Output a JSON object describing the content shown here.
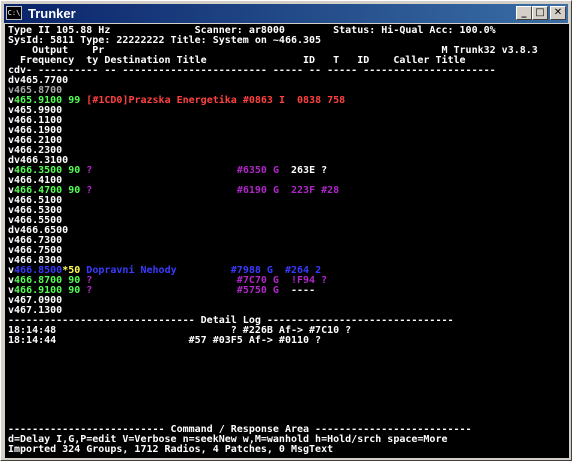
{
  "window": {
    "title": "Trunker",
    "icon_label": "C:\\",
    "buttons": {
      "minimize": "_",
      "maximize": "□",
      "close": "✕"
    }
  },
  "header": {
    "line1": "Type II 105.88 Hz              Scanner: ar8000        Status: Hi-Qual Acc: 100.0%",
    "line2": "SysId: 5811 Type: 22222222 Title: System on ~466.305",
    "line3": "    Output    Pr                                                        M Trunk32 v3.8.3",
    "line4": "  Frequency  ty Destination Title                ID   T   ID    Caller Title",
    "line5": "cdv- ---------- -- ------------------------ ----- -- ----- ----------------------"
  },
  "freq_rows": [
    {
      "segments": [
        {
          "text": "dv465.7700",
          "color": "white"
        }
      ]
    },
    {
      "segments": [
        {
          "text": "v465.8700",
          "color": "gray"
        }
      ]
    },
    {
      "segments": [
        {
          "text": "v",
          "color": "white"
        },
        {
          "text": "465.9100",
          "color": "green"
        },
        {
          "text": " 99 ",
          "color": "green"
        },
        {
          "text": "[#1CD0]Prazska Energetika #0863 I  0838 758",
          "color": "red"
        }
      ]
    },
    {
      "segments": [
        {
          "text": "v465.9900",
          "color": "white"
        }
      ]
    },
    {
      "segments": [
        {
          "text": "v466.1100",
          "color": "white"
        }
      ]
    },
    {
      "segments": [
        {
          "text": "v466.1900",
          "color": "white"
        }
      ]
    },
    {
      "segments": [
        {
          "text": "v466.2100",
          "color": "white"
        }
      ]
    },
    {
      "segments": [
        {
          "text": "v466.2300",
          "color": "white"
        }
      ]
    },
    {
      "segments": [
        {
          "text": "dv466.3100",
          "color": "white"
        }
      ]
    },
    {
      "segments": [
        {
          "text": "v",
          "color": "white"
        },
        {
          "text": "466.3500",
          "color": "green"
        },
        {
          "text": " 90 ",
          "color": "green"
        },
        {
          "text": "?",
          "color": "purple"
        },
        {
          "text": "                        ",
          "color": "white"
        },
        {
          "text": "#6350 G ",
          "color": "purple"
        },
        {
          "text": " 263E ?",
          "color": "white"
        }
      ]
    },
    {
      "segments": [
        {
          "text": "v466.4100",
          "color": "white"
        }
      ]
    },
    {
      "segments": [
        {
          "text": "v",
          "color": "white"
        },
        {
          "text": "466.4700",
          "color": "green"
        },
        {
          "text": " 90 ",
          "color": "green"
        },
        {
          "text": "?",
          "color": "purple"
        },
        {
          "text": "                        ",
          "color": "white"
        },
        {
          "text": "#6190 G  223F #28",
          "color": "purple"
        }
      ]
    },
    {
      "segments": [
        {
          "text": "v466.5100",
          "color": "white"
        }
      ]
    },
    {
      "segments": [
        {
          "text": "v466.5300",
          "color": "white"
        }
      ]
    },
    {
      "segments": [
        {
          "text": "v466.5500",
          "color": "white"
        }
      ]
    },
    {
      "segments": [
        {
          "text": "dv466.6500",
          "color": "white"
        }
      ]
    },
    {
      "segments": [
        {
          "text": "v466.7300",
          "color": "white"
        }
      ]
    },
    {
      "segments": [
        {
          "text": "v466.7500",
          "color": "white"
        }
      ]
    },
    {
      "segments": [
        {
          "text": "v466.8300",
          "color": "white"
        }
      ]
    },
    {
      "segments": [
        {
          "text": "v",
          "color": "white"
        },
        {
          "text": "466.8500",
          "color": "blue"
        },
        {
          "text": "*50 ",
          "color": "yellow"
        },
        {
          "text": "Dopravni Nehody         #7988 G  #264 2",
          "color": "blue"
        }
      ]
    },
    {
      "segments": [
        {
          "text": "v",
          "color": "white"
        },
        {
          "text": "466.8700",
          "color": "green"
        },
        {
          "text": " 90 ",
          "color": "green"
        },
        {
          "text": "?                        #7C70 G  !F94 ?",
          "color": "purple"
        }
      ]
    },
    {
      "segments": [
        {
          "text": "v",
          "color": "white"
        },
        {
          "text": "466.9100",
          "color": "green"
        },
        {
          "text": " 90 ",
          "color": "green"
        },
        {
          "text": "?                        #5750 G ",
          "color": "purple"
        },
        {
          "text": " ----",
          "color": "white"
        }
      ]
    },
    {
      "segments": [
        {
          "text": "v467.0900",
          "color": "white"
        }
      ]
    },
    {
      "segments": [
        {
          "text": "v467.1300",
          "color": "white"
        }
      ]
    }
  ],
  "detail_log": {
    "header": "------------------------------- Detail Log -------------------------------",
    "rows": [
      "18:14:48                             ? #226B Af-> #7C10 ?",
      "18:14:44                      #57 #03F5 Af-> #0110 ?"
    ]
  },
  "command_area": {
    "header": "-------------------------- Command / Response Area --------------------------",
    "help": "d=Delay I,G,P=edit V=Verbose n=seekNew w,M=wanhold h=Hold/srch space=More",
    "status": "Imported 324 Groups, 1712 Radios, 4 Patches, 0 MsgText"
  },
  "colors": {
    "background": "#000000",
    "white": "#ffffff",
    "gray": "#a8a8a8",
    "green": "#55ff55",
    "red": "#ff4040",
    "purple": "#b026c8",
    "blue": "#3a3aff",
    "yellow": "#ffff55"
  }
}
